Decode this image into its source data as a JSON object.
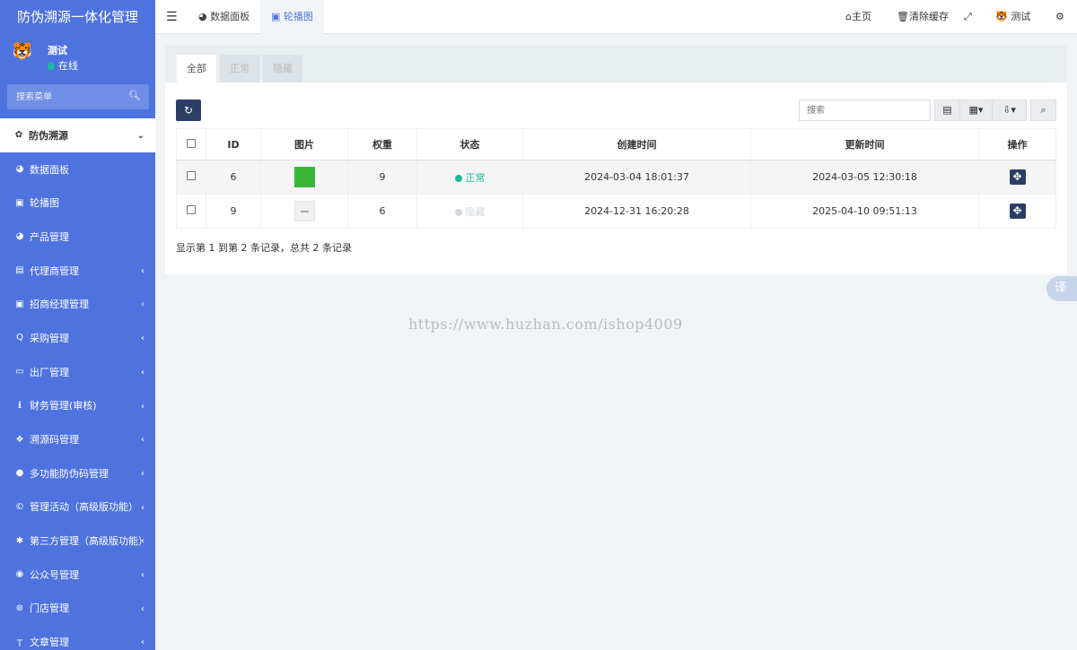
{
  "app": {
    "title": "防伪溯源一体化管理"
  },
  "user": {
    "name": "测试",
    "status": "在线"
  },
  "sidebar": {
    "search_placeholder": "搜索菜单",
    "items": [
      {
        "label": "防伪溯源",
        "icon": "flower-icon"
      },
      {
        "label": "数据面板",
        "icon": "dashboard-icon"
      },
      {
        "label": "轮播图",
        "icon": "image-icon"
      },
      {
        "label": "产品管理",
        "icon": "product-icon"
      },
      {
        "label": "代理商管理",
        "icon": "id-card-icon"
      },
      {
        "label": "招商经理管理",
        "icon": "contact-icon"
      },
      {
        "label": "采购管理",
        "icon": "search-icon"
      },
      {
        "label": "出厂管理",
        "icon": "truck-icon"
      },
      {
        "label": "财务管理(审核)",
        "icon": "info-icon"
      },
      {
        "label": "溯源码管理",
        "icon": "cubes-icon"
      },
      {
        "label": "多功能防伪码管理",
        "icon": "shield-icon"
      },
      {
        "label": "管理活动（高级版功能）",
        "icon": "copyright-icon"
      },
      {
        "label": "第三方管理（高级版功能）",
        "icon": "yelp-icon"
      },
      {
        "label": "公众号管理",
        "icon": "wechat-icon"
      },
      {
        "label": "门店管理",
        "icon": "store-icon"
      },
      {
        "label": "文章管理",
        "icon": "text-icon"
      }
    ]
  },
  "topbar": {
    "tabs": [
      "数据面板",
      "轮播图"
    ],
    "home": "主页",
    "clear_cache": "清除缓存",
    "user_name": "测试"
  },
  "content": {
    "tabs": [
      "全部",
      "正常",
      "隐藏"
    ],
    "search_placeholder": "搜索",
    "columns": [
      "ID",
      "图片",
      "权重",
      "状态",
      "创建时间",
      "更新时间",
      "操作"
    ],
    "rows": [
      {
        "id": "6",
        "weight": "9",
        "status": "正常",
        "status_color": "#18bc9c",
        "created": "2024-03-04 18:01:37",
        "updated": "2024-03-05 12:30:18"
      },
      {
        "id": "9",
        "weight": "6",
        "status": "隐藏",
        "status_color": "#d2d6de",
        "created": "2024-12-31 16:20:28",
        "updated": "2025-04-10 09:51:13"
      }
    ],
    "pagination_text": "显示第 1 到第 2 条记录，总共 2 条记录"
  },
  "watermark": "https://www.huzhan.com/ishop4009",
  "translate_label": "译",
  "colors": {
    "sidebar": "#4e73df",
    "primary_dark": "#2c3e67",
    "success": "#18bc9c"
  }
}
